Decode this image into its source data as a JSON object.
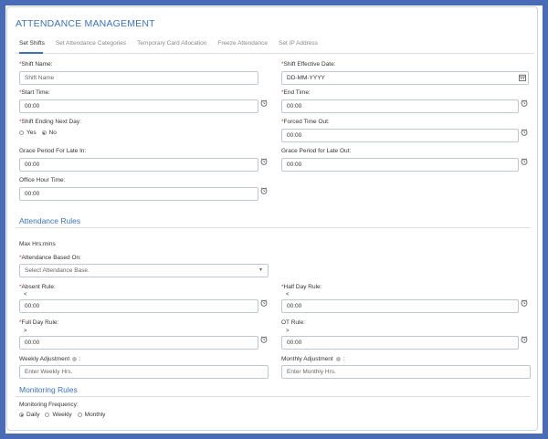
{
  "page": {
    "title": "ATTENDANCE MANAGEMENT"
  },
  "tabs": [
    {
      "label": "Set Shifts"
    },
    {
      "label": "Set Attendance Categories"
    },
    {
      "label": "Temporary Card Allocation"
    },
    {
      "label": "Freeze Attendance"
    },
    {
      "label": "Set IP Address"
    }
  ],
  "shift": {
    "shift_name_label": "Shift Name:",
    "shift_name_placeholder": "Shift Name",
    "effective_date_label": "Shift Effective Date:",
    "effective_date_placeholder": "DD-MM-YYYY",
    "start_time_label": "Start Time:",
    "start_time_value": "00:00",
    "end_time_label": "End Time:",
    "end_time_value": "00:00",
    "ending_next_day_label": "Shift Ending Next Day:",
    "yes_label": "Yes",
    "no_label": "No",
    "forced_time_out_label": "Forced Time Out:",
    "forced_time_out_value": "00:00",
    "grace_late_in_label": "Grace Period For Late In:",
    "grace_late_in_value": "00:00",
    "grace_late_out_label": "Grace Period for Late Out:",
    "grace_late_out_value": "00:00",
    "office_hour_label": "Office Hour Time:",
    "office_hour_value": "00:00"
  },
  "attendance_rules": {
    "title": "Attendance Rules",
    "max_hrs_label": "Max Hrs:mins",
    "based_on_label": "Attendance Based On:",
    "based_on_placeholder": "Select Attendance Base.",
    "absent_rule_label": "Absent Rule:",
    "absent_rule_symbol": "<",
    "absent_rule_value": "00:00",
    "half_day_rule_label": "Half Day Rule:",
    "half_day_rule_symbol": "<",
    "half_day_rule_value": "00:00",
    "full_day_rule_label": "Full Day Rule:",
    "full_day_rule_symbol": ">",
    "full_day_rule_value": "00:00",
    "ot_rule_label": "OT Rule:",
    "ot_rule_symbol": ">",
    "ot_rule_value": "00:00",
    "weekly_adjustment_label": "Weekly Adjustment",
    "weekly_adjustment_placeholder": "Enter Weekly Hrs.",
    "monthly_adjustment_label": "Monthly Adjustment",
    "monthly_adjustment_placeholder": "Enter Monthly Hrs."
  },
  "monitoring_rules": {
    "title": "Monitoring Rules",
    "frequency_label": "Monitoring Frequency:",
    "options": [
      {
        "label": "Daily",
        "selected": true
      },
      {
        "label": "Weekly",
        "selected": false
      },
      {
        "label": "Monthly",
        "selected": false
      }
    ]
  },
  "colors": {
    "accent": "#3c73b4",
    "frame": "#4a6bb6",
    "required": "#dd3333"
  }
}
